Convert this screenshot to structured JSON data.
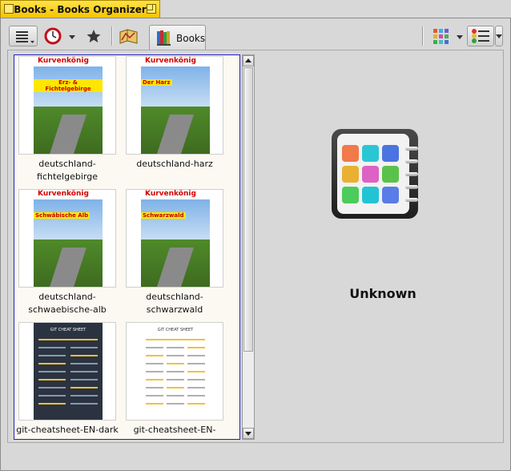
{
  "window": {
    "title": "Books - Books Organizer"
  },
  "toolbar": {
    "tab_label": "Books"
  },
  "books": [
    {
      "name": "deutschland-fichtelgebirge",
      "caption_lines": [
        "deutschland-",
        "fichtelgebirge"
      ],
      "cover_label": "Erz- & Fichtelgebirge",
      "brand": "Kurvenkönig"
    },
    {
      "name": "deutschland-harz",
      "caption_lines": [
        "deutschland-harz"
      ],
      "cover_label": "Der Harz",
      "brand": "Kurvenkönig"
    },
    {
      "name": "deutschland-schwaebische-alb",
      "caption_lines": [
        "deutschland-",
        "schwaebische-alb"
      ],
      "cover_label": "Schwäbische Alb",
      "brand": "Kurvenkönig"
    },
    {
      "name": "deutschland-schwarzwald",
      "caption_lines": [
        "deutschland-schwarzwald"
      ],
      "cover_label": "Schwarzwald",
      "brand": "Kurvenkönig"
    },
    {
      "name": "git-cheatsheet-EN-dark",
      "caption_lines": [
        "git-cheatsheet-EN-dark"
      ],
      "cover_label": "GIT CHEAT SHEET",
      "theme": "dark"
    },
    {
      "name": "git-cheatsheet-EN-white",
      "caption_lines": [
        "git-cheatsheet-EN-white"
      ],
      "cover_label": "GIT CHEAT SHEET",
      "theme": "light"
    }
  ],
  "preview": {
    "status_text": "Unknown"
  },
  "colors": {
    "title_tab": "#f5c400",
    "selection_border": "#2020c0",
    "grid_background": "#fbf9f2"
  }
}
